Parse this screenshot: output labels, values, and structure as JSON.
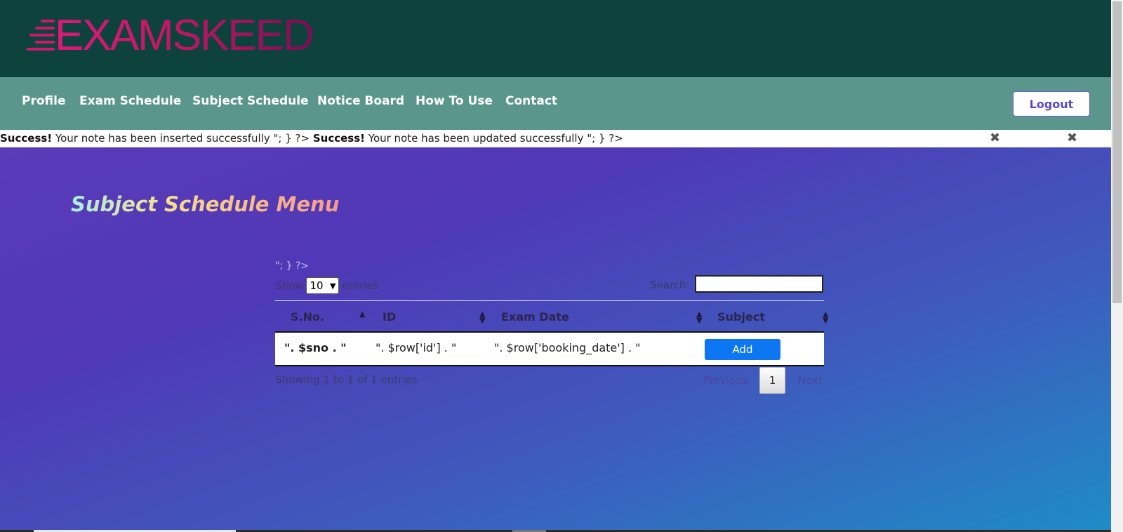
{
  "brand": {
    "logo_text": "EXAMSKEED",
    "colors": {
      "header_bg": "#0e433d",
      "navbar_bg": "#5a968b",
      "logo_pink": "#d3166e",
      "logo_teal": "#1aa6a0"
    }
  },
  "nav": {
    "items": [
      {
        "label": "Profile"
      },
      {
        "label": "Exam Schedule"
      },
      {
        "label": "Subject Schedule"
      },
      {
        "label": "Notice Board"
      },
      {
        "label": "How To Use"
      },
      {
        "label": "Contact"
      }
    ],
    "logout_label": "Logout"
  },
  "alerts": {
    "first": {
      "strong": "Success!",
      "message": " Your note has been inserted successfully \"; } ?> "
    },
    "second": {
      "strong": "Success!",
      "message": " Your note has been updated successfully \"; } ?>"
    },
    "close_icon": "close-icon"
  },
  "page": {
    "title": "Subject Schedule Menu",
    "stray_text": "\"; } ?>",
    "accent_gradient": [
      "#5a3bb8",
      "#1e8cc6"
    ]
  },
  "table_controls": {
    "show_label": "Show",
    "entries_label": "entries",
    "length_value": "10",
    "search_label": "Search:",
    "search_value": ""
  },
  "table": {
    "columns": [
      "S.No.",
      "ID",
      "Exam Date",
      "Subject"
    ],
    "rows": [
      {
        "sno": "\". $sno . \"",
        "id": "\". $row['id'] . \"",
        "date": "\". $row['booking_date'] . \"",
        "action": "Add"
      }
    ],
    "info": "Showing 1 to 1 of 1 entries",
    "pagination": {
      "previous": "Previous",
      "current": "1",
      "next": "Next"
    }
  }
}
